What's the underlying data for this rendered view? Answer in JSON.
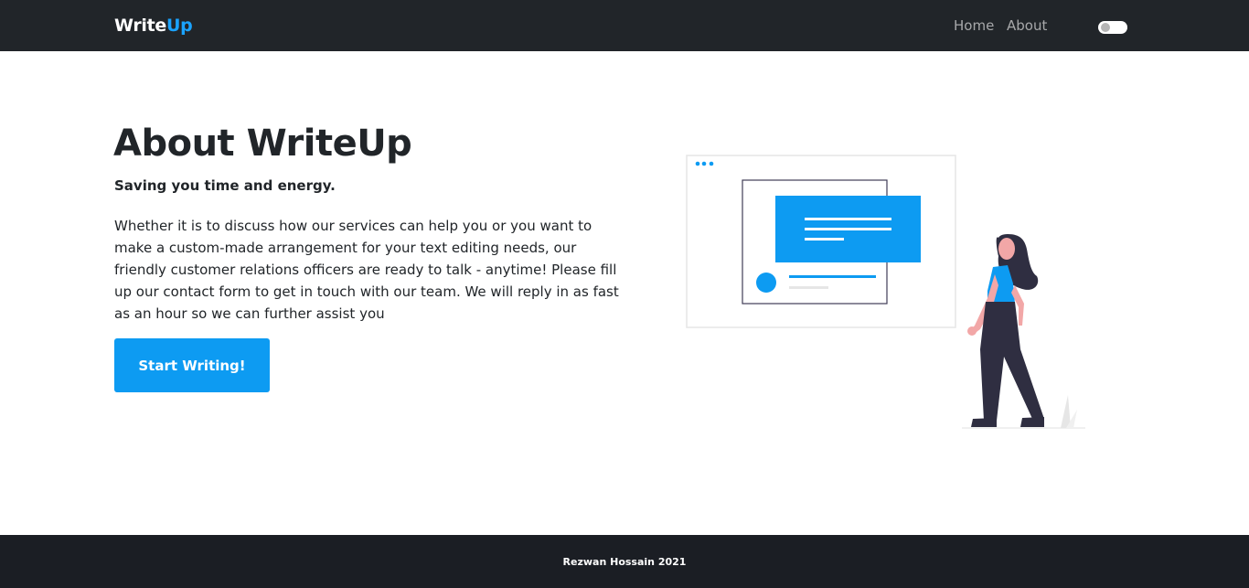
{
  "nav": {
    "brand_primary": "Write",
    "brand_accent": "Up",
    "links": [
      {
        "label": "Home"
      },
      {
        "label": "About"
      }
    ],
    "theme_toggle_on": false
  },
  "hero": {
    "title": "About WriteUp",
    "subtitle": "Saving you time and energy.",
    "body": "Whether it is to discuss how our services can help you or you want to make a custom-made arrangement for your text editing needs, our friendly customer relations officers are ready to talk - anytime! Please fill up our contact form to get in touch with our team. We will reply in as fast as an hour so we can further assist you",
    "cta_label": "Start Writing!"
  },
  "footer": {
    "text": "Rezwan Hossain 2021"
  },
  "colors": {
    "navbar_bg": "#212529",
    "accent": "#0d9bf2",
    "footer_bg": "#1b1e24"
  }
}
